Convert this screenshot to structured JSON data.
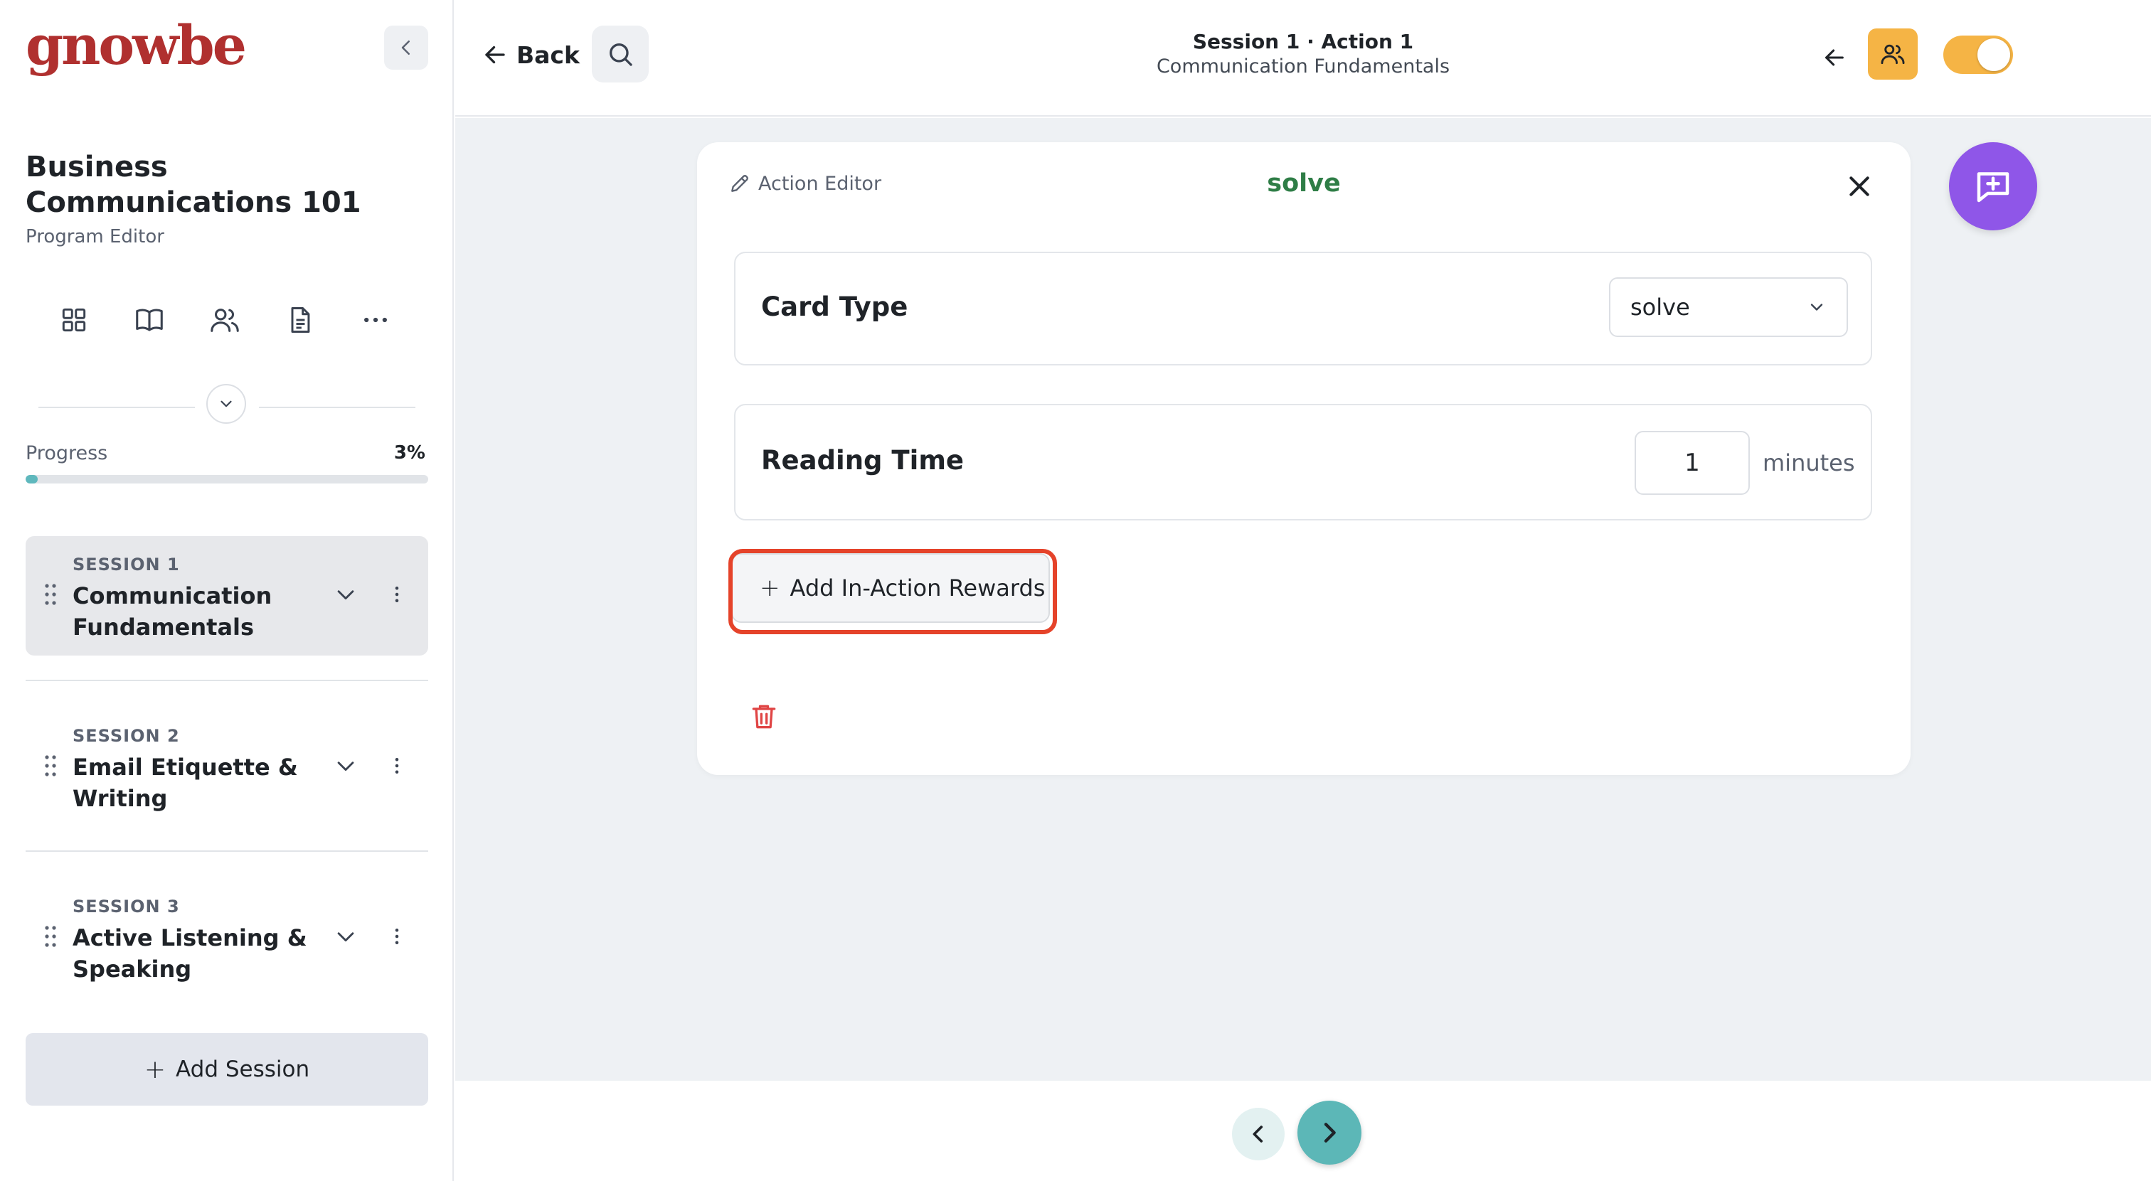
{
  "app": {
    "logo_text": "gnowbe",
    "brand_color": "#b0302f"
  },
  "sidebar": {
    "program_title": "Business Communications 101",
    "program_subtitle": "Program Editor",
    "icons": [
      "grid-icon",
      "book-icon",
      "users-icon",
      "document-icon",
      "more-icon"
    ],
    "progress": {
      "label": "Progress",
      "value_text": "3%",
      "value": 3
    },
    "sessions": [
      {
        "label": "SESSION 1",
        "title": "Communication Fundamentals",
        "active": true
      },
      {
        "label": "SESSION 2",
        "title": "Email Etiquette & Writing",
        "active": false
      },
      {
        "label": "SESSION 3",
        "title": "Active Listening & Speaking",
        "active": false
      }
    ],
    "add_session_label": "Add Session"
  },
  "header": {
    "back_label": "Back",
    "breadcrumb_title": "Session 1 · Action 1",
    "breadcrumb_subtitle": "Communication Fundamentals",
    "toggle_on": true,
    "accent_color": "#f5b445"
  },
  "editor": {
    "label": "Action Editor",
    "card_type_heading": "solve",
    "card_type_color": "#2e7d46",
    "card_type_label": "Card Type",
    "card_type_value": "solve",
    "reading_time_label": "Reading Time",
    "reading_time_value": "1",
    "reading_time_unit": "minutes",
    "add_rewards_label": "Add In-Action Rewards",
    "highlight_color": "#e5432a"
  },
  "fab": {
    "icon": "add-comment-icon",
    "color": "#8f56e8"
  },
  "pager": {
    "next_color": "#5cb7b7"
  }
}
